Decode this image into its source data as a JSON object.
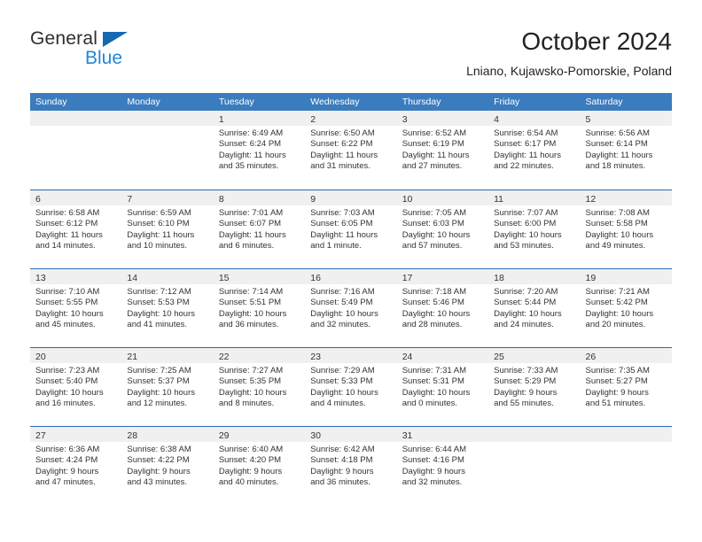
{
  "brand": {
    "name_part1": "General",
    "name_part2": "Blue",
    "accent_color": "#1668b3",
    "blue_text_color": "#2288d8"
  },
  "header": {
    "title": "October 2024",
    "subtitle": "Lniano, Kujawsko-Pomorskie, Poland"
  },
  "calendar": {
    "header_bg": "#3a7cbe",
    "row_rule_color": "#2a6aad",
    "day_band_bg": "#f0f0f0",
    "weekdays": [
      "Sunday",
      "Monday",
      "Tuesday",
      "Wednesday",
      "Thursday",
      "Friday",
      "Saturday"
    ],
    "weeks": [
      [
        {
          "day": "",
          "empty": true,
          "sunrise": "",
          "sunset": "",
          "daylight_line1": "",
          "daylight_line2": ""
        },
        {
          "day": "",
          "empty": true,
          "sunrise": "",
          "sunset": "",
          "daylight_line1": "",
          "daylight_line2": ""
        },
        {
          "day": "1",
          "sunrise": "Sunrise: 6:49 AM",
          "sunset": "Sunset: 6:24 PM",
          "daylight_line1": "Daylight: 11 hours",
          "daylight_line2": "and 35 minutes."
        },
        {
          "day": "2",
          "sunrise": "Sunrise: 6:50 AM",
          "sunset": "Sunset: 6:22 PM",
          "daylight_line1": "Daylight: 11 hours",
          "daylight_line2": "and 31 minutes."
        },
        {
          "day": "3",
          "sunrise": "Sunrise: 6:52 AM",
          "sunset": "Sunset: 6:19 PM",
          "daylight_line1": "Daylight: 11 hours",
          "daylight_line2": "and 27 minutes."
        },
        {
          "day": "4",
          "sunrise": "Sunrise: 6:54 AM",
          "sunset": "Sunset: 6:17 PM",
          "daylight_line1": "Daylight: 11 hours",
          "daylight_line2": "and 22 minutes."
        },
        {
          "day": "5",
          "sunrise": "Sunrise: 6:56 AM",
          "sunset": "Sunset: 6:14 PM",
          "daylight_line1": "Daylight: 11 hours",
          "daylight_line2": "and 18 minutes."
        }
      ],
      [
        {
          "day": "6",
          "sunrise": "Sunrise: 6:58 AM",
          "sunset": "Sunset: 6:12 PM",
          "daylight_line1": "Daylight: 11 hours",
          "daylight_line2": "and 14 minutes."
        },
        {
          "day": "7",
          "sunrise": "Sunrise: 6:59 AM",
          "sunset": "Sunset: 6:10 PM",
          "daylight_line1": "Daylight: 11 hours",
          "daylight_line2": "and 10 minutes."
        },
        {
          "day": "8",
          "sunrise": "Sunrise: 7:01 AM",
          "sunset": "Sunset: 6:07 PM",
          "daylight_line1": "Daylight: 11 hours",
          "daylight_line2": "and 6 minutes."
        },
        {
          "day": "9",
          "sunrise": "Sunrise: 7:03 AM",
          "sunset": "Sunset: 6:05 PM",
          "daylight_line1": "Daylight: 11 hours",
          "daylight_line2": "and 1 minute."
        },
        {
          "day": "10",
          "sunrise": "Sunrise: 7:05 AM",
          "sunset": "Sunset: 6:03 PM",
          "daylight_line1": "Daylight: 10 hours",
          "daylight_line2": "and 57 minutes."
        },
        {
          "day": "11",
          "sunrise": "Sunrise: 7:07 AM",
          "sunset": "Sunset: 6:00 PM",
          "daylight_line1": "Daylight: 10 hours",
          "daylight_line2": "and 53 minutes."
        },
        {
          "day": "12",
          "sunrise": "Sunrise: 7:08 AM",
          "sunset": "Sunset: 5:58 PM",
          "daylight_line1": "Daylight: 10 hours",
          "daylight_line2": "and 49 minutes."
        }
      ],
      [
        {
          "day": "13",
          "sunrise": "Sunrise: 7:10 AM",
          "sunset": "Sunset: 5:55 PM",
          "daylight_line1": "Daylight: 10 hours",
          "daylight_line2": "and 45 minutes."
        },
        {
          "day": "14",
          "sunrise": "Sunrise: 7:12 AM",
          "sunset": "Sunset: 5:53 PM",
          "daylight_line1": "Daylight: 10 hours",
          "daylight_line2": "and 41 minutes."
        },
        {
          "day": "15",
          "sunrise": "Sunrise: 7:14 AM",
          "sunset": "Sunset: 5:51 PM",
          "daylight_line1": "Daylight: 10 hours",
          "daylight_line2": "and 36 minutes."
        },
        {
          "day": "16",
          "sunrise": "Sunrise: 7:16 AM",
          "sunset": "Sunset: 5:49 PM",
          "daylight_line1": "Daylight: 10 hours",
          "daylight_line2": "and 32 minutes."
        },
        {
          "day": "17",
          "sunrise": "Sunrise: 7:18 AM",
          "sunset": "Sunset: 5:46 PM",
          "daylight_line1": "Daylight: 10 hours",
          "daylight_line2": "and 28 minutes."
        },
        {
          "day": "18",
          "sunrise": "Sunrise: 7:20 AM",
          "sunset": "Sunset: 5:44 PM",
          "daylight_line1": "Daylight: 10 hours",
          "daylight_line2": "and 24 minutes."
        },
        {
          "day": "19",
          "sunrise": "Sunrise: 7:21 AM",
          "sunset": "Sunset: 5:42 PM",
          "daylight_line1": "Daylight: 10 hours",
          "daylight_line2": "and 20 minutes."
        }
      ],
      [
        {
          "day": "20",
          "sunrise": "Sunrise: 7:23 AM",
          "sunset": "Sunset: 5:40 PM",
          "daylight_line1": "Daylight: 10 hours",
          "daylight_line2": "and 16 minutes."
        },
        {
          "day": "21",
          "sunrise": "Sunrise: 7:25 AM",
          "sunset": "Sunset: 5:37 PM",
          "daylight_line1": "Daylight: 10 hours",
          "daylight_line2": "and 12 minutes."
        },
        {
          "day": "22",
          "sunrise": "Sunrise: 7:27 AM",
          "sunset": "Sunset: 5:35 PM",
          "daylight_line1": "Daylight: 10 hours",
          "daylight_line2": "and 8 minutes."
        },
        {
          "day": "23",
          "sunrise": "Sunrise: 7:29 AM",
          "sunset": "Sunset: 5:33 PM",
          "daylight_line1": "Daylight: 10 hours",
          "daylight_line2": "and 4 minutes."
        },
        {
          "day": "24",
          "sunrise": "Sunrise: 7:31 AM",
          "sunset": "Sunset: 5:31 PM",
          "daylight_line1": "Daylight: 10 hours",
          "daylight_line2": "and 0 minutes."
        },
        {
          "day": "25",
          "sunrise": "Sunrise: 7:33 AM",
          "sunset": "Sunset: 5:29 PM",
          "daylight_line1": "Daylight: 9 hours",
          "daylight_line2": "and 55 minutes."
        },
        {
          "day": "26",
          "sunrise": "Sunrise: 7:35 AM",
          "sunset": "Sunset: 5:27 PM",
          "daylight_line1": "Daylight: 9 hours",
          "daylight_line2": "and 51 minutes."
        }
      ],
      [
        {
          "day": "27",
          "sunrise": "Sunrise: 6:36 AM",
          "sunset": "Sunset: 4:24 PM",
          "daylight_line1": "Daylight: 9 hours",
          "daylight_line2": "and 47 minutes."
        },
        {
          "day": "28",
          "sunrise": "Sunrise: 6:38 AM",
          "sunset": "Sunset: 4:22 PM",
          "daylight_line1": "Daylight: 9 hours",
          "daylight_line2": "and 43 minutes."
        },
        {
          "day": "29",
          "sunrise": "Sunrise: 6:40 AM",
          "sunset": "Sunset: 4:20 PM",
          "daylight_line1": "Daylight: 9 hours",
          "daylight_line2": "and 40 minutes."
        },
        {
          "day": "30",
          "sunrise": "Sunrise: 6:42 AM",
          "sunset": "Sunset: 4:18 PM",
          "daylight_line1": "Daylight: 9 hours",
          "daylight_line2": "and 36 minutes."
        },
        {
          "day": "31",
          "sunrise": "Sunrise: 6:44 AM",
          "sunset": "Sunset: 4:16 PM",
          "daylight_line1": "Daylight: 9 hours",
          "daylight_line2": "and 32 minutes."
        },
        {
          "day": "",
          "empty": true,
          "sunrise": "",
          "sunset": "",
          "daylight_line1": "",
          "daylight_line2": ""
        },
        {
          "day": "",
          "empty": true,
          "sunrise": "",
          "sunset": "",
          "daylight_line1": "",
          "daylight_line2": ""
        }
      ]
    ]
  }
}
